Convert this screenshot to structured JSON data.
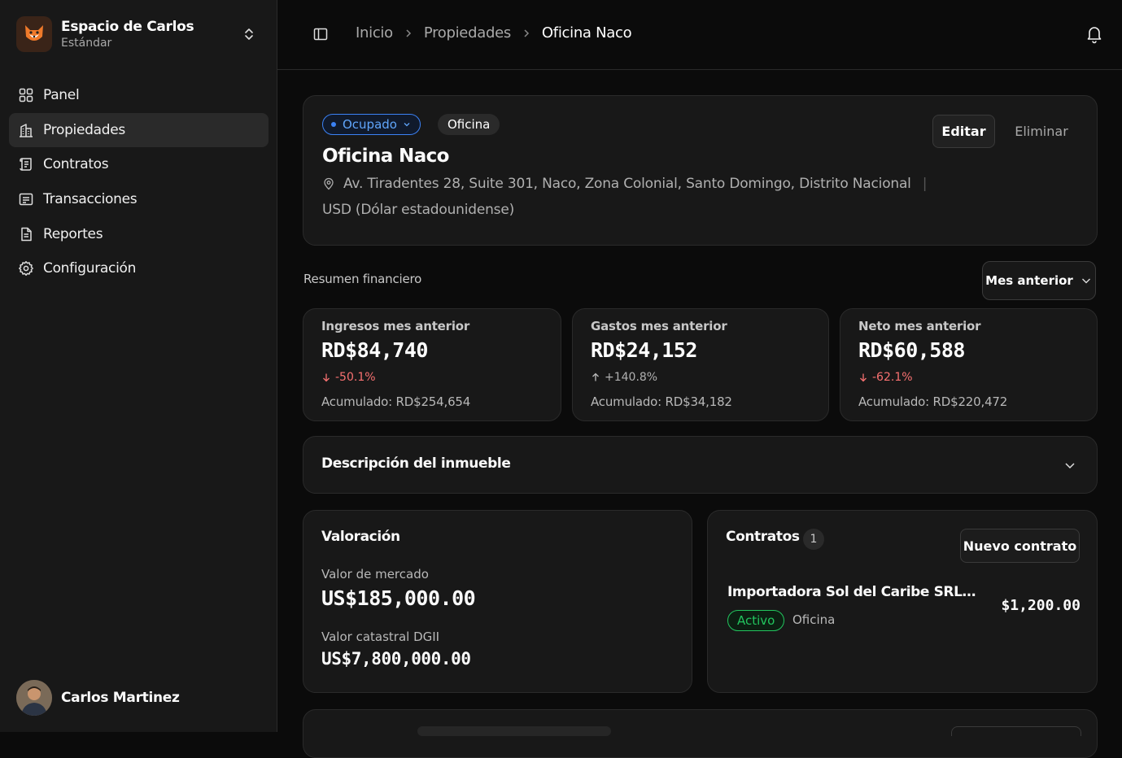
{
  "workspace": {
    "name": "Espacio de Carlos",
    "plan": "Estándar"
  },
  "nav": [
    {
      "label": "Panel",
      "icon": "grid-icon",
      "active": false
    },
    {
      "label": "Propiedades",
      "icon": "building-icon",
      "active": true
    },
    {
      "label": "Contratos",
      "icon": "scroll-icon",
      "active": false
    },
    {
      "label": "Transacciones",
      "icon": "receipt-icon",
      "active": false
    },
    {
      "label": "Reportes",
      "icon": "file-icon",
      "active": false
    },
    {
      "label": "Configuración",
      "icon": "gear-icon",
      "active": false
    }
  ],
  "user": {
    "name": "Carlos Martinez"
  },
  "breadcrumb": [
    "Inicio",
    "Propiedades",
    "Oficina Naco"
  ],
  "property": {
    "status": "Ocupado",
    "type": "Oficina",
    "name": "Oficina Naco",
    "address": "Av. Tiradentes 28, Suite 301, Naco, Zona Colonial, Santo Domingo, Distrito Nacional",
    "currency": "USD (Dólar estadounidense)",
    "edit_label": "Editar",
    "delete_label": "Eliminar"
  },
  "finance": {
    "title": "Resumen financiero",
    "period": "Mes anterior",
    "cards": [
      {
        "label": "Ingresos mes anterior",
        "value": "RD$84,740",
        "change": "-50.1%",
        "direction": "down",
        "accumulated": "Acumulado: RD$254,654"
      },
      {
        "label": "Gastos mes anterior",
        "value": "RD$24,152",
        "change": "+140.8%",
        "direction": "up",
        "accumulated": "Acumulado: RD$34,182"
      },
      {
        "label": "Neto mes anterior",
        "value": "RD$60,588",
        "change": "-62.1%",
        "direction": "down",
        "accumulated": "Acumulado: RD$220,472"
      }
    ]
  },
  "description": {
    "title": "Descripción del inmueble"
  },
  "valuation": {
    "title": "Valoración",
    "market_label": "Valor de mercado",
    "market_value": "US$185,000.00",
    "cadastral_label": "Valor catastral DGII",
    "cadastral_value": "US$7,800,000.00"
  },
  "contracts": {
    "title": "Contratos",
    "count": "1",
    "new_label": "Nuevo contrato",
    "items": [
      {
        "party": "Importadora Sol del Caribe SRL José",
        "amount": "$1,200.00",
        "status": "Activo",
        "kind": "Oficina"
      }
    ]
  },
  "colors": {
    "accent_blue": "#3b82f6",
    "success": "#22c55e",
    "danger": "#f87171"
  }
}
